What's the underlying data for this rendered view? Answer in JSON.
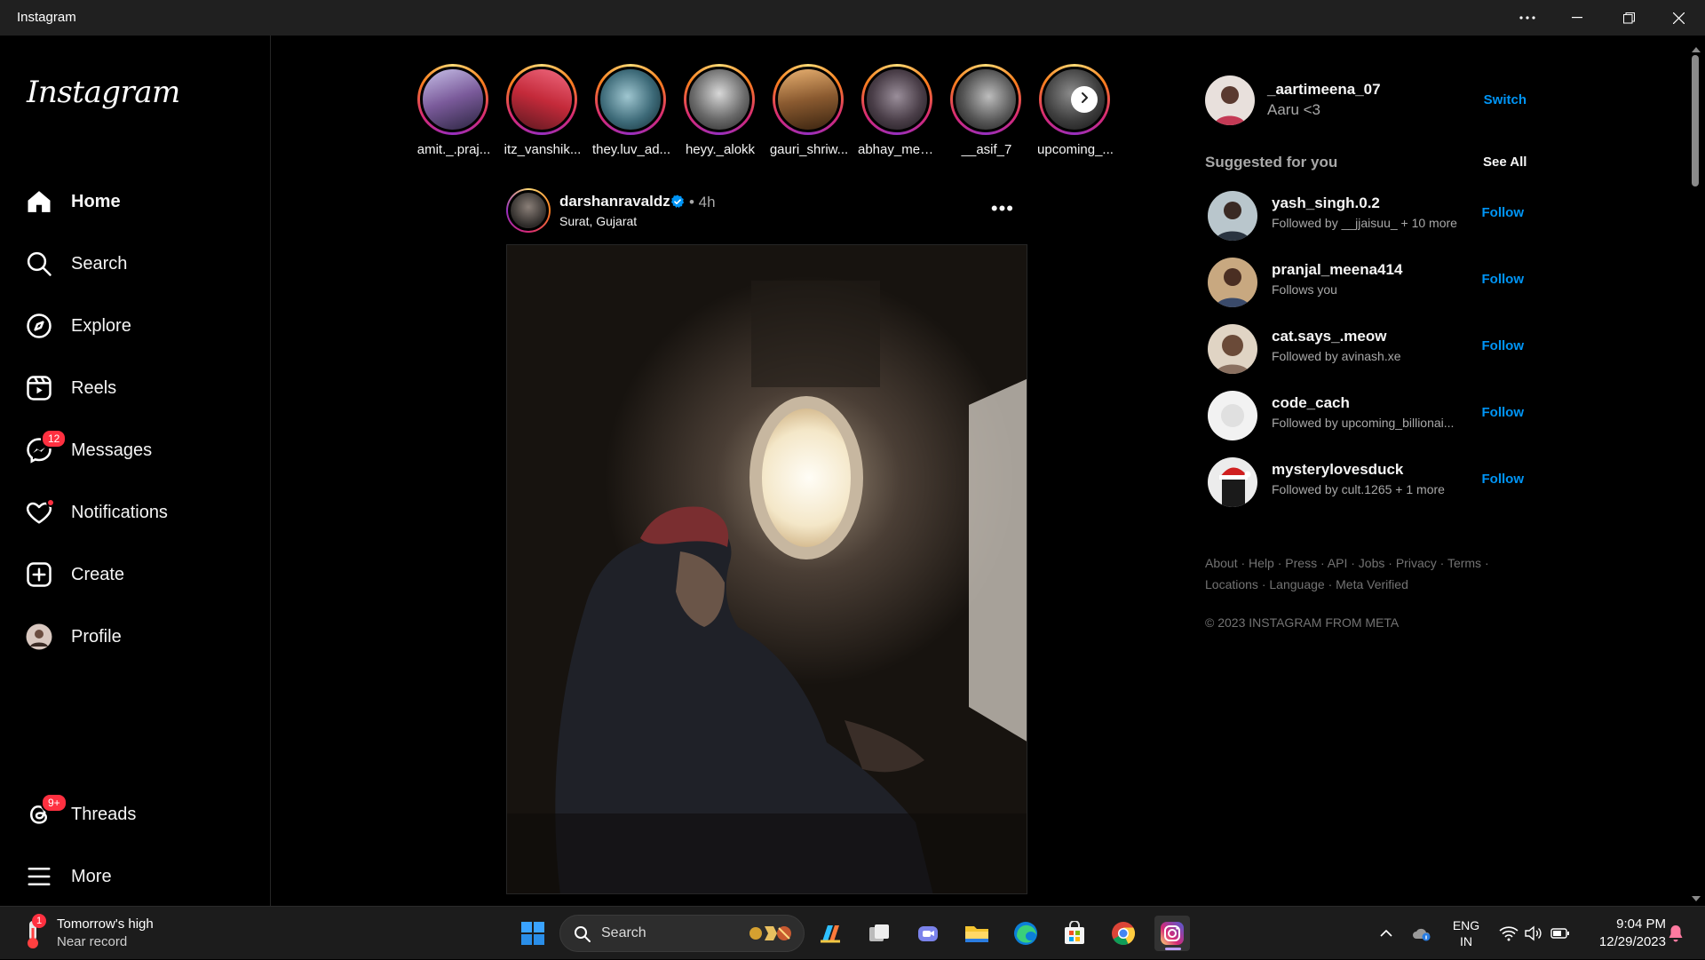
{
  "window": {
    "title": "Instagram"
  },
  "sidebar": {
    "logo": "Instagram",
    "items": [
      {
        "label": "Home",
        "icon": "home-icon",
        "active": true
      },
      {
        "label": "Search",
        "icon": "search-icon"
      },
      {
        "label": "Explore",
        "icon": "compass-icon"
      },
      {
        "label": "Reels",
        "icon": "reels-icon"
      },
      {
        "label": "Messages",
        "icon": "messenger-icon",
        "badge": "12"
      },
      {
        "label": "Notifications",
        "icon": "heart-icon",
        "dot": true
      },
      {
        "label": "Create",
        "icon": "plus-square-icon"
      },
      {
        "label": "Profile",
        "icon": "avatar"
      },
      {
        "label": "Threads",
        "icon": "threads-icon",
        "badge": "9+"
      },
      {
        "label": "More",
        "icon": "menu-icon"
      }
    ]
  },
  "stories": [
    {
      "name": "amit._.praj..."
    },
    {
      "name": "itz_vanshik..."
    },
    {
      "name": "they.luv_ad..."
    },
    {
      "name": "heyy._alokk"
    },
    {
      "name": "gauri_shriw..."
    },
    {
      "name": "abhay_mee..."
    },
    {
      "name": "__asif_7"
    },
    {
      "name": "upcoming_..."
    }
  ],
  "post": {
    "username": "darshanravaldz",
    "time": "• 4h",
    "location": "Surat, Gujarat",
    "more": "•••"
  },
  "account": {
    "username": "_aartimeena_07",
    "name": "Aaru <3",
    "switch_label": "Switch"
  },
  "suggestions": {
    "title": "Suggested for you",
    "see_all": "See All",
    "items": [
      {
        "username": "yash_singh.0.2",
        "sub": "Followed by __jjaisuu_ + 10 more",
        "action": "Follow"
      },
      {
        "username": "pranjal_meena414",
        "sub": "Follows you",
        "action": "Follow"
      },
      {
        "username": "cat.says_.meow",
        "sub": "Followed by avinash.xe",
        "action": "Follow"
      },
      {
        "username": "code_cach",
        "sub": "Followed by upcoming_billionai...",
        "action": "Follow"
      },
      {
        "username": "mysterylovesduck",
        "sub": "Followed by cult.1265 + 1 more",
        "action": "Follow"
      }
    ]
  },
  "footer": {
    "links": [
      "About",
      "Help",
      "Press",
      "API",
      "Jobs",
      "Privacy",
      "Terms",
      "Locations",
      "Language",
      "Meta Verified"
    ],
    "copyright": "© 2023 INSTAGRAM FROM META"
  },
  "taskbar": {
    "weather_line1": "Tomorrow's high",
    "weather_line2": "Near record",
    "weather_badge": "1",
    "search_label": "Search",
    "lang1": "ENG",
    "lang2": "IN",
    "time": "9:04 PM",
    "date": "12/29/2023"
  }
}
